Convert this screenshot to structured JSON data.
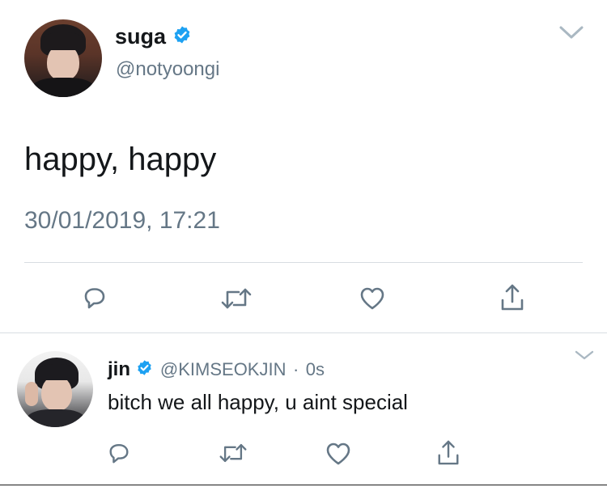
{
  "main_tweet": {
    "display_name": "suga",
    "handle": "@notyoongi",
    "text": "happy, happy",
    "timestamp": "30/01/2019, 17:21",
    "verified": true
  },
  "reply": {
    "display_name": "jin",
    "handle": "@KIMSEOKJIN",
    "separator": "·",
    "time": "0s",
    "text": "bitch we all happy, u aint special",
    "verified": true
  },
  "icons": {
    "chevron": "chevron-down-icon",
    "reply": "reply-icon",
    "retweet": "retweet-icon",
    "like": "heart-icon",
    "share": "share-icon",
    "verified": "verified-badge-icon"
  },
  "colors": {
    "text": "#14171a",
    "secondary": "#657786",
    "verified": "#1da1f2",
    "divider": "#d8dde2"
  }
}
